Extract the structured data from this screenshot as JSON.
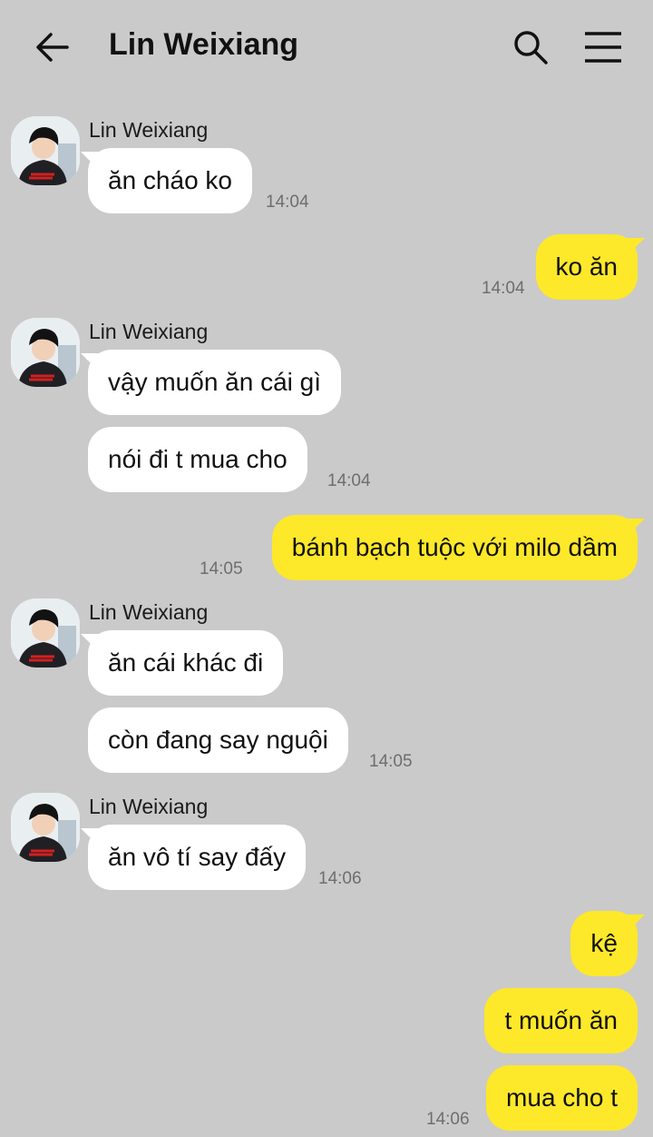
{
  "header": {
    "title": "Lin Weixiang"
  },
  "messages": [
    {
      "sender": "Lin Weixiang",
      "text": "ăn cháo ko",
      "time": "14:04"
    },
    {
      "text": "ko ăn",
      "time": "14:04"
    },
    {
      "sender": "Lin Weixiang",
      "text": "vậy muốn ăn cái gì"
    },
    {
      "text": "nói đi t mua cho",
      "time": "14:04"
    },
    {
      "text": "bánh bạch tuộc với milo dầm",
      "time": "14:05"
    },
    {
      "sender": "Lin Weixiang",
      "text": "ăn cái khác đi"
    },
    {
      "text": "còn đang say nguội",
      "time": "14:05"
    },
    {
      "sender": "Lin Weixiang",
      "text": "ăn vô tí say đấy",
      "time": "14:06"
    },
    {
      "text": "kệ"
    },
    {
      "text": "t muốn ăn"
    },
    {
      "text": "mua cho t",
      "time": "14:06"
    }
  ],
  "colors": {
    "background": "#cacaca",
    "incoming_bubble": "#ffffff",
    "outgoing_bubble": "#fde82a"
  },
  "icons": [
    "back-arrow-icon",
    "search-icon",
    "menu-icon",
    "avatar-photo"
  ]
}
